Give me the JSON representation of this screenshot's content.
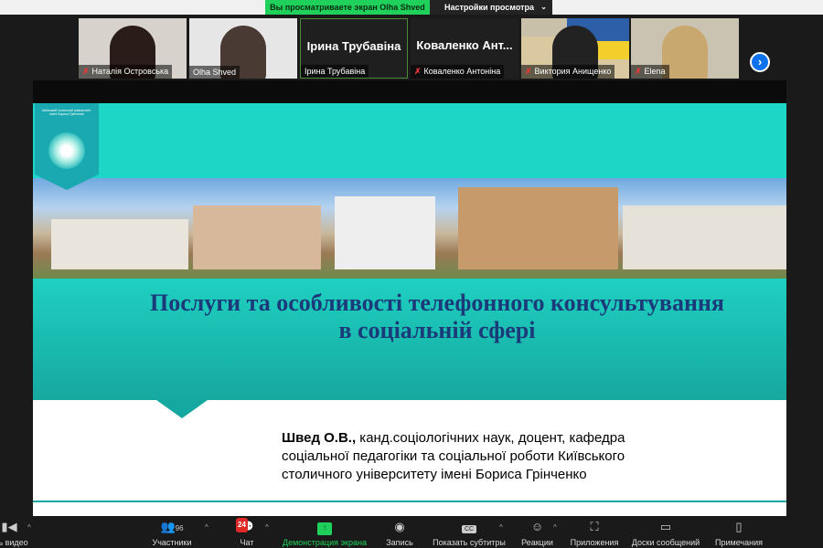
{
  "top": {
    "share_banner": "Вы просматриваете экран Olha Shved",
    "view_settings": "Настройки просмотра"
  },
  "participants": [
    {
      "name": "Наталія Островська",
      "muted": true,
      "video": true
    },
    {
      "name": "Olha Shved",
      "muted": false,
      "video": true
    },
    {
      "name": "Ірина  Трубавіна",
      "display": "Ірина  Трубавіна",
      "muted": false,
      "video": false
    },
    {
      "name": "Коваленко Антоніна",
      "display": "Коваленко  Ант...",
      "muted": true,
      "video": false
    },
    {
      "name": "Виктория Анищенко",
      "muted": true,
      "video": true
    },
    {
      "name": "Elena",
      "muted": true,
      "video": true
    }
  ],
  "slide": {
    "logo_text": "Київський столичний університет імені Бориса Грінченка",
    "title_line1": "Послуги та особливості телефонного консультування",
    "title_line2": "в соціальній сфері",
    "author_name": "Швед О.В.,",
    "author_line1": " канд.соціологічних наук, доцент, кафедра",
    "author_line2": "соціальної педагогіки та соціальної роботи Київського",
    "author_line3": "столичного університету імені Бориса Грінченко"
  },
  "toolbar": {
    "video": "ить видео",
    "participants": "Участники",
    "participants_count": "96",
    "chat": "Чат",
    "chat_badge": "24",
    "share": "Демонстрация экрана",
    "record": "Запись",
    "captions": "Показать субтитры",
    "reactions": "Реакции",
    "apps": "Приложения",
    "whiteboards": "Доски сообщений",
    "notes": "Примечания"
  }
}
